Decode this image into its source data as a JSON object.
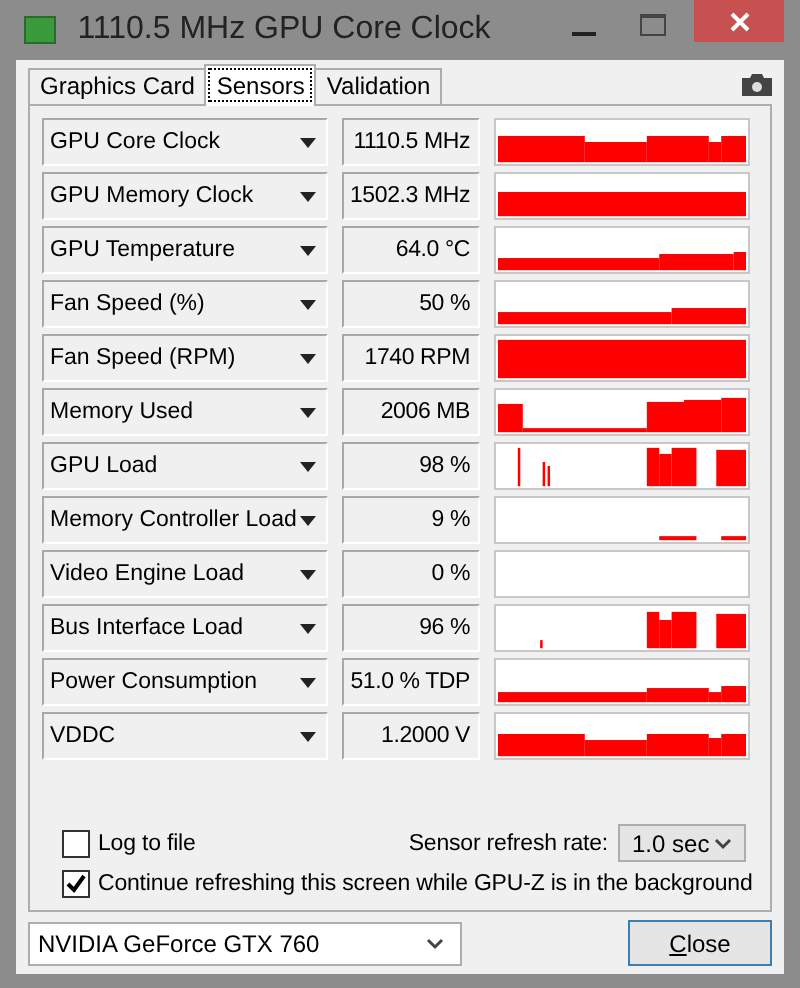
{
  "window": {
    "title": "1110.5 MHz GPU Core Clock"
  },
  "tabs": [
    {
      "label": "Graphics Card",
      "selected": false
    },
    {
      "label": "Sensors",
      "selected": true
    },
    {
      "label": "Validation",
      "selected": false
    }
  ],
  "sensors": [
    {
      "name": "GPU Core Clock",
      "value": "1110.5 MHz"
    },
    {
      "name": "GPU Memory Clock",
      "value": "1502.3 MHz"
    },
    {
      "name": "GPU Temperature",
      "value": "64.0 °C"
    },
    {
      "name": "Fan Speed (%)",
      "value": "50 %"
    },
    {
      "name": "Fan Speed (RPM)",
      "value": "1740 RPM"
    },
    {
      "name": "Memory Used",
      "value": "2006 MB"
    },
    {
      "name": "GPU Load",
      "value": "98 %"
    },
    {
      "name": "Memory Controller Load",
      "value": "9 %"
    },
    {
      "name": "Video Engine Load",
      "value": "0 %"
    },
    {
      "name": "Bus Interface Load",
      "value": "96 %"
    },
    {
      "name": "Power Consumption",
      "value": "51.0 % TDP"
    },
    {
      "name": "VDDC",
      "value": "1.2000 V"
    }
  ],
  "options": [
    {
      "label": "Log to file",
      "checked": false
    },
    {
      "label": "Continue refreshing this screen while GPU-Z is in the background",
      "checked": true
    }
  ],
  "refresh_rate": {
    "label": "Sensor refresh rate:",
    "value": "1.0 sec"
  },
  "gpu_select": {
    "value": "NVIDIA GeForce GTX 760"
  },
  "close_button": {
    "label": "Close"
  }
}
